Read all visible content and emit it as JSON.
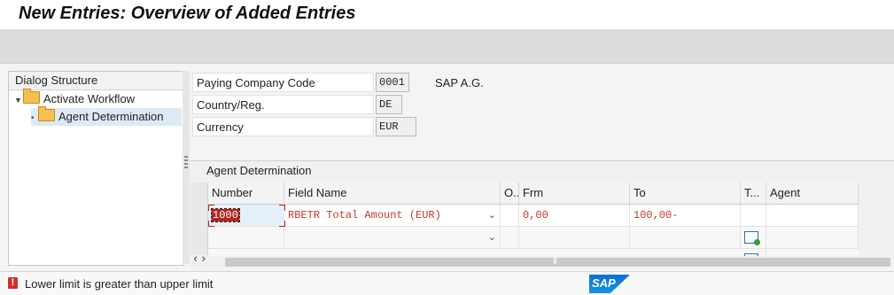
{
  "title": "New Entries: Overview of Added Entries",
  "dialog": {
    "header": "Dialog Structure",
    "items": [
      {
        "label": "Activate Workflow"
      },
      {
        "label": "Agent Determination"
      }
    ]
  },
  "header_fields": [
    {
      "label": "Paying Company Code",
      "value": "0001"
    },
    {
      "label": "Country/Reg.",
      "value": "DE"
    },
    {
      "label": "Currency",
      "value": "EUR"
    }
  ],
  "company_name": "SAP A.G.",
  "table": {
    "title": "Agent Determination",
    "columns": [
      "Number",
      "Field Name",
      "O..",
      "Frm",
      "To",
      "T...",
      "Agent"
    ],
    "rows": [
      {
        "number": "1000",
        "field_name": "RBETR Total Amount (EUR)",
        "op": "",
        "from": "0,00",
        "to": "100,00-",
        "type": "",
        "agent": ""
      },
      {
        "number": "",
        "field_name": "",
        "op": "",
        "from": "",
        "to": "",
        "type": "",
        "agent": ""
      }
    ]
  },
  "status": {
    "message": "Lower limit is greater than upper limit",
    "type": "error",
    "icon": "error-icon"
  },
  "logo_text": "SAP",
  "colors": {
    "error": "#d32f2f",
    "accent": "#0a6fd1"
  }
}
